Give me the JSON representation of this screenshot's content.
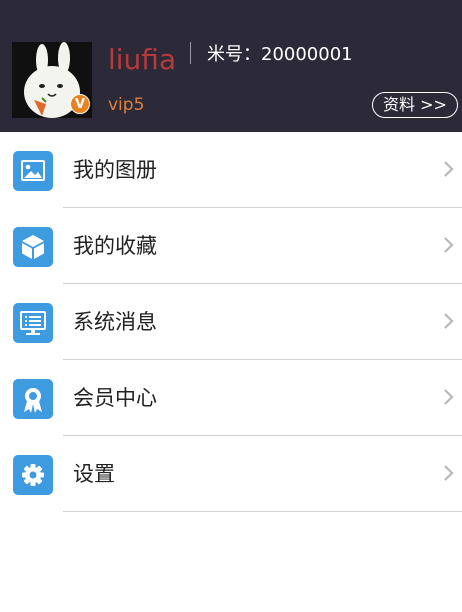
{
  "profile": {
    "username": "liufia",
    "account_label": "米号：20000001",
    "vip_level": "vip5",
    "badge": "V",
    "profile_button": "资料 >>"
  },
  "menu": [
    {
      "label": "我的图册",
      "icon": "image-icon"
    },
    {
      "label": "我的收藏",
      "icon": "box-icon"
    },
    {
      "label": "系统消息",
      "icon": "monitor-icon"
    },
    {
      "label": "会员中心",
      "icon": "ribbon-icon"
    },
    {
      "label": "设置",
      "icon": "gear-icon"
    }
  ],
  "colors": {
    "header_bg": "#2c2a38",
    "username": "#b73a3a",
    "vip": "#e0813a",
    "icon_bg": "#3f9be0"
  }
}
